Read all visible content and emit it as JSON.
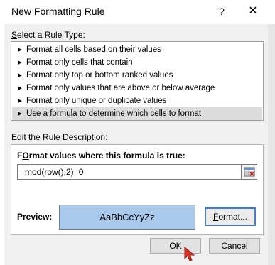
{
  "window": {
    "title": "New Formatting Rule",
    "help_glyph": "?",
    "close_glyph": "✕"
  },
  "rule_type": {
    "label_accel": "S",
    "label_rest": "elect a Rule Type:",
    "items": [
      "Format all cells based on their values",
      "Format only cells that contain",
      "Format only top or bottom ranked values",
      "Format only values that are above or below average",
      "Format only unique or duplicate values",
      "Use a formula to determine which cells to format"
    ],
    "selected_index": 5,
    "item_arrow": "►"
  },
  "description": {
    "label_accel": "E",
    "label_rest": "dit the Rule Description:",
    "heading_accel": "O",
    "heading_pre": "F",
    "heading_rest": "rmat values where this formula is true:",
    "formula_value": "=mod(row(),2)=0",
    "preview_label": "Preview:",
    "preview_sample": "AaBbCcYyZz",
    "preview_fill": "#a8c8ec",
    "format_button_accel": "F",
    "format_button_rest": "ormat..."
  },
  "buttons": {
    "ok": "OK",
    "cancel": "Cancel"
  },
  "icons": {
    "collapse": "range-selector-icon",
    "cursor": "mouse-pointer-icon"
  }
}
